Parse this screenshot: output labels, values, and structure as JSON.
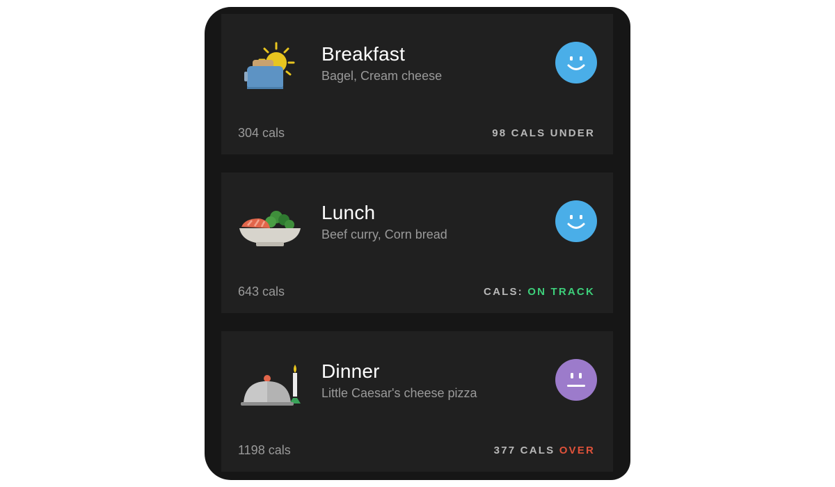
{
  "colors": {
    "happy": "#4aaee8",
    "neutral": "#9c7bcb",
    "on_track": "#3dcf7a",
    "over": "#e0523a"
  },
  "meals": [
    {
      "title": "Breakfast",
      "items": "Bagel, Cream cheese",
      "cals": "304 cals",
      "status": "98 CALS UNDER",
      "icon": "toaster-sun-icon",
      "mood": "happy-face-icon"
    },
    {
      "title": "Lunch",
      "items": "Beef curry, Corn bread",
      "cals": "643 cals",
      "status_prefix": "CALS:",
      "status_highlight": "ON TRACK",
      "icon": "salad-bowl-icon",
      "mood": "happy-face-icon"
    },
    {
      "title": "Dinner",
      "items": "Little Caesar's cheese pizza",
      "cals": "1198 cals",
      "status_prefix": "377 CALS",
      "status_highlight": "OVER",
      "icon": "cloche-candle-icon",
      "mood": "neutral-face-icon"
    }
  ]
}
